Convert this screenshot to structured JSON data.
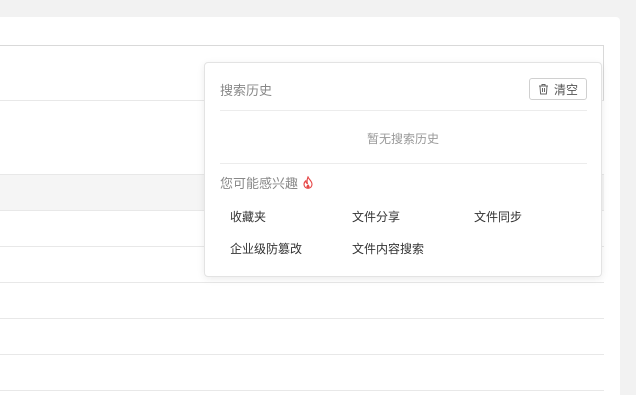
{
  "dropdown": {
    "history_title": "搜索历史",
    "clear_label": "清空",
    "empty_text": "暂无搜索历史",
    "suggest_title": "您可能感兴趣",
    "suggestions": [
      "收藏夹",
      "文件分享",
      "文件同步",
      "企业级防篡改",
      "文件内容搜索"
    ]
  },
  "icons": {
    "clear": "trash-icon",
    "hot": "flame-icon"
  },
  "colors": {
    "hot_icon": "#e64545"
  }
}
